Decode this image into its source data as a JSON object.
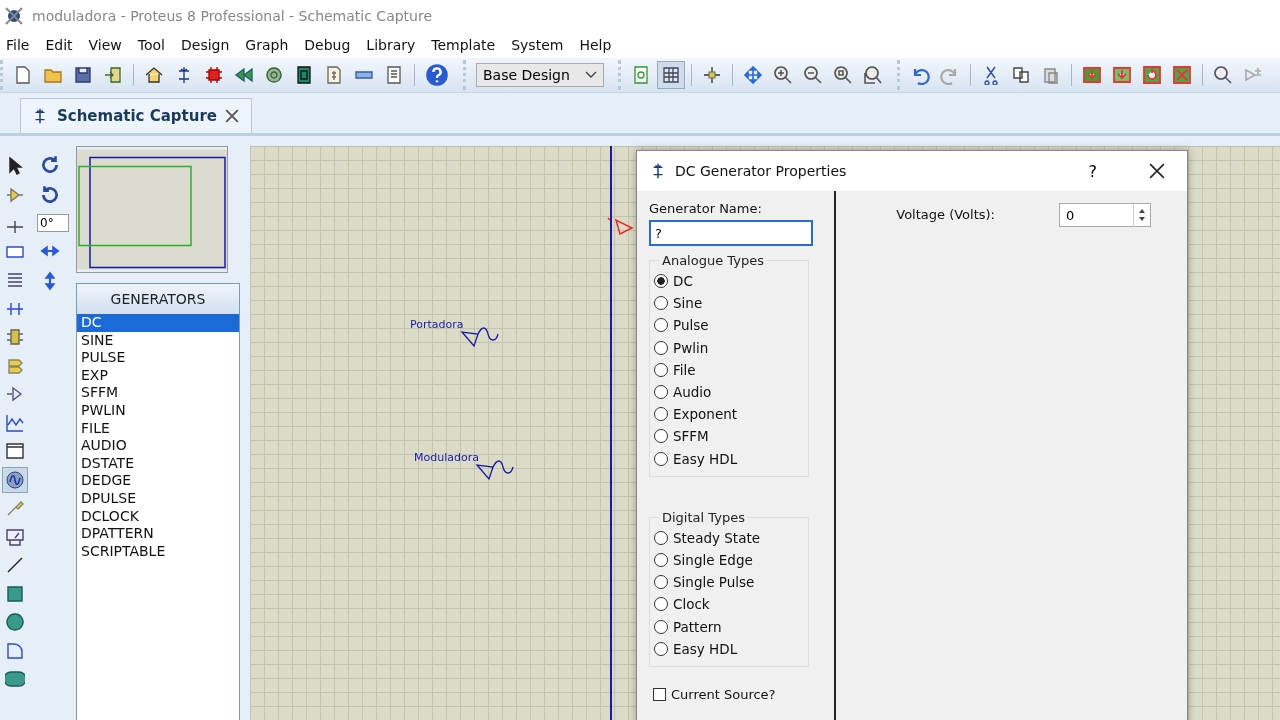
{
  "window": {
    "title": "moduladora - Proteus 8 Professional - Schematic Capture"
  },
  "menu": [
    "File",
    "Edit",
    "View",
    "Tool",
    "Design",
    "Graph",
    "Debug",
    "Library",
    "Template",
    "System",
    "Help"
  ],
  "toolbar": {
    "design_select": "Base Design"
  },
  "tabs": [
    {
      "label": "Schematic Capture",
      "selected": true
    }
  ],
  "rotation": {
    "value": "0°"
  },
  "generators": {
    "title": "GENERATORS",
    "items": [
      {
        "label": "DC",
        "selected": true
      },
      {
        "label": "SINE",
        "selected": false
      },
      {
        "label": "PULSE",
        "selected": false
      },
      {
        "label": "EXP",
        "selected": false
      },
      {
        "label": "SFFM",
        "selected": false
      },
      {
        "label": "PWLIN",
        "selected": false
      },
      {
        "label": "FILE",
        "selected": false
      },
      {
        "label": "AUDIO",
        "selected": false
      },
      {
        "label": "DSTATE",
        "selected": false
      },
      {
        "label": "DEDGE",
        "selected": false
      },
      {
        "label": "DPULSE",
        "selected": false
      },
      {
        "label": "DCLOCK",
        "selected": false
      },
      {
        "label": "DPATTERN",
        "selected": false
      },
      {
        "label": "SCRIPTABLE",
        "selected": false
      }
    ]
  },
  "canvas": {
    "generator_labels": [
      "Portadora",
      "Moduladora"
    ]
  },
  "dialog": {
    "title": "DC Generator Properties",
    "help": "?",
    "name_label": "Generator Name:",
    "name_value": "?",
    "analogue": {
      "title": "Analogue Types",
      "options": [
        {
          "label": "DC",
          "selected": true
        },
        {
          "label": "Sine",
          "selected": false
        },
        {
          "label": "Pulse",
          "selected": false
        },
        {
          "label": "Pwlin",
          "selected": false
        },
        {
          "label": "File",
          "selected": false
        },
        {
          "label": "Audio",
          "selected": false
        },
        {
          "label": "Exponent",
          "selected": false
        },
        {
          "label": "SFFM",
          "selected": false
        },
        {
          "label": "Easy HDL",
          "selected": false
        }
      ]
    },
    "digital": {
      "title": "Digital Types",
      "options": [
        {
          "label": "Steady State",
          "selected": false
        },
        {
          "label": "Single Edge",
          "selected": false
        },
        {
          "label": "Single Pulse",
          "selected": false
        },
        {
          "label": "Clock",
          "selected": false
        },
        {
          "label": "Pattern",
          "selected": false
        },
        {
          "label": "Easy HDL",
          "selected": false
        }
      ]
    },
    "voltage": {
      "label": "Voltage (Volts):",
      "value": "0"
    },
    "current_source": {
      "label": "Current Source?",
      "checked": false
    }
  }
}
